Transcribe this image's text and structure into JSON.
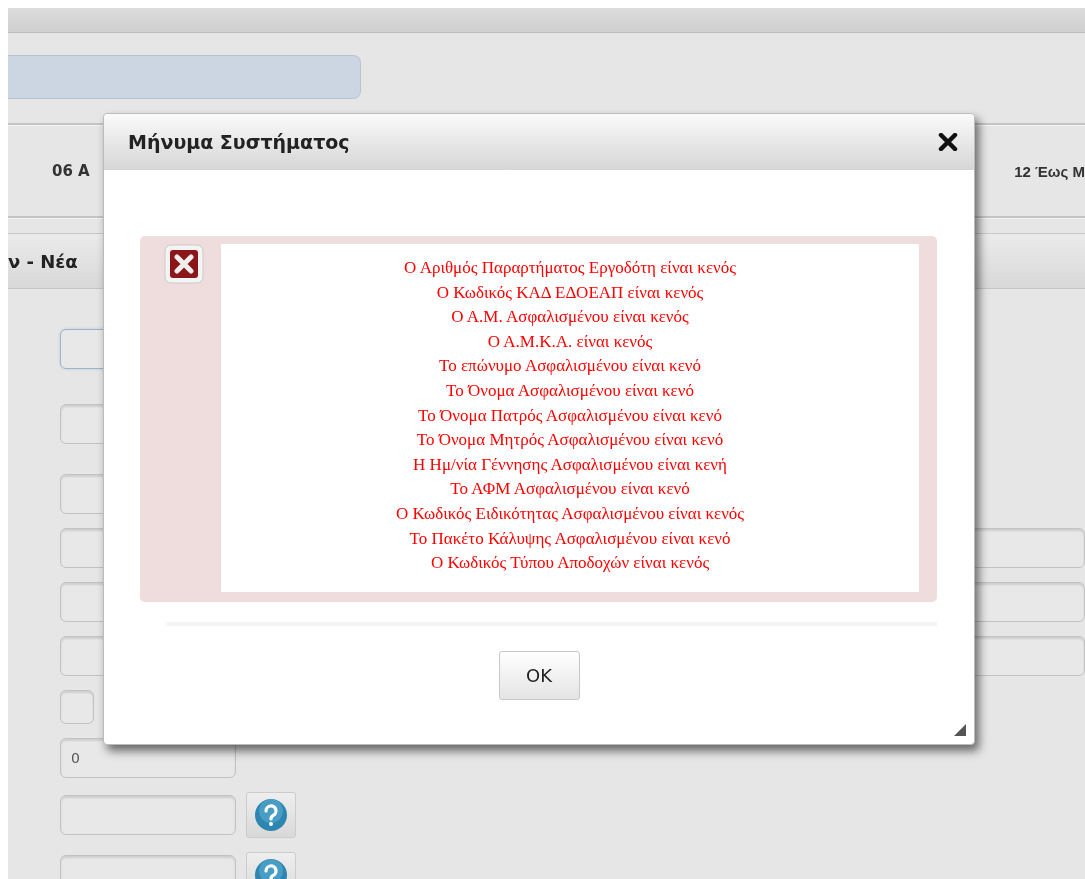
{
  "page": {
    "tabs": [
      {
        "label": "06 Α"
      },
      {
        "label": "12 Έως Μ"
      }
    ],
    "section_title": "ν - Νέα",
    "fields": [
      {
        "kind": "input",
        "focused": true
      },
      {
        "kind": "input",
        "focused": false
      },
      {
        "kind": "input",
        "focused": false
      },
      {
        "kind": "wide",
        "focused": false
      },
      {
        "kind": "wide",
        "focused": false
      },
      {
        "kind": "wide",
        "focused": false
      },
      {
        "kind": "short",
        "focused": false
      },
      {
        "kind": "input",
        "focused": false,
        "value": "0"
      },
      {
        "kind": "help",
        "focused": false
      },
      {
        "kind": "help",
        "focused": false
      }
    ]
  },
  "dialog": {
    "title": "Μήνυμα Συστήματος",
    "messages": [
      "Ο Αριθμός Παραρτήματος Εργοδότη είναι κενός",
      "Ο Κωδικός ΚΑΔ ΕΔΟΕΑΠ είναι κενός",
      "Ο Α.Μ. Ασφαλισμένου είναι κενός",
      "Ο Α.Μ.Κ.Α. είναι κενός",
      "Το επώνυμο Ασφαλισμένου είναι κενό",
      "Το Όνομα Ασφαλισμένου είναι κενό",
      "Το Όνομα Πατρός Ασφαλισμένου είναι κενό",
      "Το Όνομα Μητρός Ασφαλισμένου είναι κενό",
      "Η Ημ/νία Γέννησης Ασφαλισμένου είναι κενή",
      "Το ΑΦΜ Ασφαλισμένου είναι κενό",
      "Ο Κωδικός Ειδικότητας Ασφαλισμένου είναι κενός",
      "Το Πακέτο Κάλυψης Ασφαλισμένου είναι κενό",
      "Ο Κωδικός Τύπου Αποδοχών είναι κενός"
    ],
    "ok_button": "OK"
  }
}
